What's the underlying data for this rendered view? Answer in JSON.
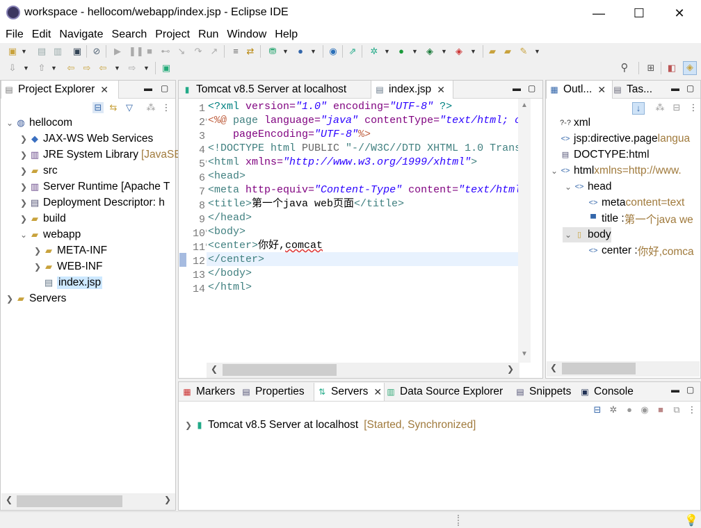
{
  "window": {
    "title": "workspace - hellocom/webapp/index.jsp - Eclipse IDE",
    "minimize": "—",
    "maximize": "☐",
    "close": "✕"
  },
  "menu": [
    "File",
    "Edit",
    "Navigate",
    "Search",
    "Project",
    "Run",
    "Window",
    "Help"
  ],
  "project_explorer": {
    "tab_label": "Project Explorer",
    "tree": [
      {
        "label": "hellocom",
        "level": 0,
        "expanded": true,
        "icon": "project-icon"
      },
      {
        "label": "JAX-WS Web Services",
        "level": 1,
        "icon": "webservices-icon"
      },
      {
        "label": "JRE System Library",
        "deco": "[JavaSE",
        "level": 1,
        "icon": "library-icon"
      },
      {
        "label": "src",
        "level": 1,
        "icon": "source-folder-icon"
      },
      {
        "label": "Server Runtime [Apache T",
        "level": 1,
        "icon": "library-icon"
      },
      {
        "label": "Deployment Descriptor: h",
        "level": 1,
        "icon": "descriptor-icon"
      },
      {
        "label": "build",
        "level": 1,
        "icon": "folder-icon"
      },
      {
        "label": "webapp",
        "level": 1,
        "expanded": true,
        "icon": "folder-icon"
      },
      {
        "label": "META-INF",
        "level": 2,
        "icon": "folder-icon"
      },
      {
        "label": "WEB-INF",
        "level": 2,
        "icon": "folder-icon"
      },
      {
        "label": "index.jsp",
        "level": 2,
        "selected": true,
        "icon": "jsp-file-icon"
      },
      {
        "label": "Servers",
        "level": 0,
        "icon": "servers-folder-icon"
      }
    ]
  },
  "editor": {
    "tabs": [
      {
        "label": "Tomcat v8.5 Server at localhost"
      },
      {
        "label": "index.jsp",
        "active": true
      }
    ],
    "line_numbers": [
      "1",
      "2",
      "3",
      "4",
      "5",
      "6",
      "7",
      "8",
      "9",
      "10",
      "11",
      "12",
      "13",
      "14"
    ],
    "lines": [
      [
        {
          "t": "<?xml ",
          "c": "pi"
        },
        {
          "t": "version=",
          "c": "attr"
        },
        {
          "t": "\"1.0\"",
          "c": "val"
        },
        {
          "t": " encoding=",
          "c": "attr"
        },
        {
          "t": "\"UTF-8\"",
          "c": "val"
        },
        {
          "t": " ?>",
          "c": "pi"
        }
      ],
      [
        {
          "t": "<%@ ",
          "c": "jsp"
        },
        {
          "t": "page ",
          "c": "tag"
        },
        {
          "t": "language=",
          "c": "attr"
        },
        {
          "t": "\"java\"",
          "c": "val"
        },
        {
          "t": " contentType=",
          "c": "attr"
        },
        {
          "t": "\"text/html; c",
          "c": "val"
        }
      ],
      [
        {
          "t": "    pageEncoding=",
          "c": "attr"
        },
        {
          "t": "\"UTF-8\"",
          "c": "val"
        },
        {
          "t": "%>",
          "c": "jsp"
        }
      ],
      [
        {
          "t": "<!DOCTYPE ",
          "c": "tag"
        },
        {
          "t": "html ",
          "c": "tag"
        },
        {
          "t": "PUBLIC ",
          "c": "gray"
        },
        {
          "t": "\"-//W3C//DTD XHTML 1.0 Trans",
          "c": "tag"
        }
      ],
      [
        {
          "t": "<html ",
          "c": "tag"
        },
        {
          "t": "xmlns=",
          "c": "attr"
        },
        {
          "t": "\"http://www.w3.org/1999/xhtml\"",
          "c": "val"
        },
        {
          "t": ">",
          "c": "tag"
        }
      ],
      [
        {
          "t": "<head>",
          "c": "tag"
        }
      ],
      [
        {
          "t": "<meta ",
          "c": "tag"
        },
        {
          "t": "http-equiv=",
          "c": "attr"
        },
        {
          "t": "\"Content-Type\"",
          "c": "val"
        },
        {
          "t": " content=",
          "c": "attr"
        },
        {
          "t": "\"text/html",
          "c": "val"
        }
      ],
      [
        {
          "t": "<title>",
          "c": "tag"
        },
        {
          "t": "第一个java web页面",
          "c": "txt"
        },
        {
          "t": "</title>",
          "c": "tag"
        }
      ],
      [
        {
          "t": "</head>",
          "c": "tag"
        }
      ],
      [
        {
          "t": "<body>",
          "c": "tag"
        }
      ],
      [
        {
          "t": "<center>",
          "c": "tag"
        },
        {
          "t": "你好,",
          "c": "txt"
        },
        {
          "t": "comcat",
          "c": "txt"
        }
      ],
      [
        {
          "t": "</center>",
          "c": "tag"
        }
      ],
      [
        {
          "t": "</body>",
          "c": "tag"
        }
      ],
      [
        {
          "t": "</html>",
          "c": "tag"
        }
      ]
    ],
    "folds": [
      "2",
      "5",
      "10",
      "11"
    ],
    "current_line": 12
  },
  "outline": {
    "tabs": [
      {
        "label": "Outl..."
      },
      {
        "label": "Tas..."
      }
    ],
    "tree": [
      {
        "label": "xml",
        "level": 0,
        "icon": "xml-pi-icon"
      },
      {
        "label": "jsp:directive.page",
        "deco": " langua",
        "level": 0,
        "icon": "element-icon"
      },
      {
        "label": "DOCTYPE:html",
        "level": 0,
        "icon": "doctype-icon"
      },
      {
        "label": "html",
        "deco": " xmlns=http://www.",
        "level": 0,
        "expanded": true,
        "icon": "element-icon"
      },
      {
        "label": "head",
        "level": 1,
        "expanded": true,
        "icon": "element-icon"
      },
      {
        "label": "meta",
        "deco": " content=text",
        "level": 2,
        "icon": "element-icon"
      },
      {
        "label": "title : ",
        "deco": "第一个java we",
        "level": 2,
        "icon": "title-icon"
      },
      {
        "label": "body",
        "level": 1,
        "expanded": true,
        "selected": true,
        "icon": "body-icon"
      },
      {
        "label": "center : ",
        "deco": "你好,comca",
        "level": 2,
        "icon": "element-icon"
      }
    ]
  },
  "bottom": {
    "tabs": [
      {
        "label": "Markers",
        "icon": "markers-icon"
      },
      {
        "label": "Properties",
        "icon": "properties-icon"
      },
      {
        "label": "Servers",
        "icon": "servers-icon",
        "active": true
      },
      {
        "label": "Data Source Explorer",
        "icon": "datasource-icon"
      },
      {
        "label": "Snippets",
        "icon": "snippets-icon"
      },
      {
        "label": "Console",
        "icon": "console-icon"
      }
    ],
    "server": {
      "name": "Tomcat v8.5 Server at localhost",
      "status": "[Started, Synchronized]"
    }
  }
}
